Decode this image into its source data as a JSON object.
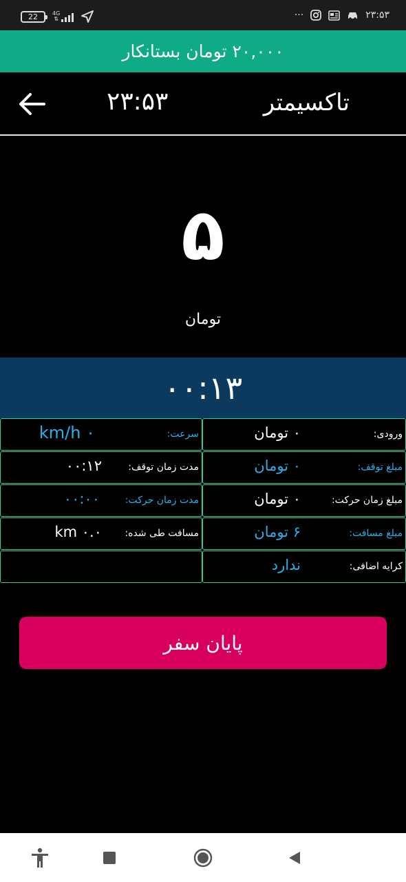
{
  "status_bar": {
    "battery": "22",
    "network": "4G",
    "dots": "···",
    "time": "۲۳:۵۳"
  },
  "banner": {
    "text": "۲۰,۰۰۰ تومان بستانکار"
  },
  "header": {
    "time": "۲۳:۵۳",
    "title": "تاکسیمتر"
  },
  "fare": {
    "value": "۵",
    "unit": "تومان"
  },
  "timer": {
    "elapsed": "۰۰:۱۳"
  },
  "details": {
    "entry_label": "ورودی:",
    "entry_value": "۰ تومان",
    "speed_label": "سرعت:",
    "speed_value": "۰ km/h",
    "stop_cost_label": "مبلغ توقف:",
    "stop_cost_value": "۰ تومان",
    "stop_time_label": "مدت زمان توقف:",
    "stop_time_value": "۰۰:۱۲",
    "move_cost_label": "مبلغ زمان حرکت:",
    "move_cost_value": "۰ تومان",
    "move_time_label": "مدت زمان حرکت:",
    "move_time_value": "۰۰:۰۰",
    "distance_cost_label": "مبلغ مسافت:",
    "distance_cost_value": "۶ تومان",
    "distance_label": "مسافت طی شده:",
    "distance_value": "۰.۰ km",
    "extra_label": "کرایه اضافی:",
    "extra_value": "ندارد"
  },
  "end_button": {
    "label": "پایان سفر"
  },
  "colors": {
    "banner": "#0faa86",
    "timer_band": "#0c3a5e",
    "accent_blue": "#28b0ea",
    "end_button": "#d8005e",
    "grid_border": "#39c9a6"
  },
  "icons": {
    "back": "arrow-left-icon",
    "nav": [
      "accessibility-icon",
      "recents-square-icon",
      "home-circle-icon",
      "back-triangle-icon"
    ]
  }
}
